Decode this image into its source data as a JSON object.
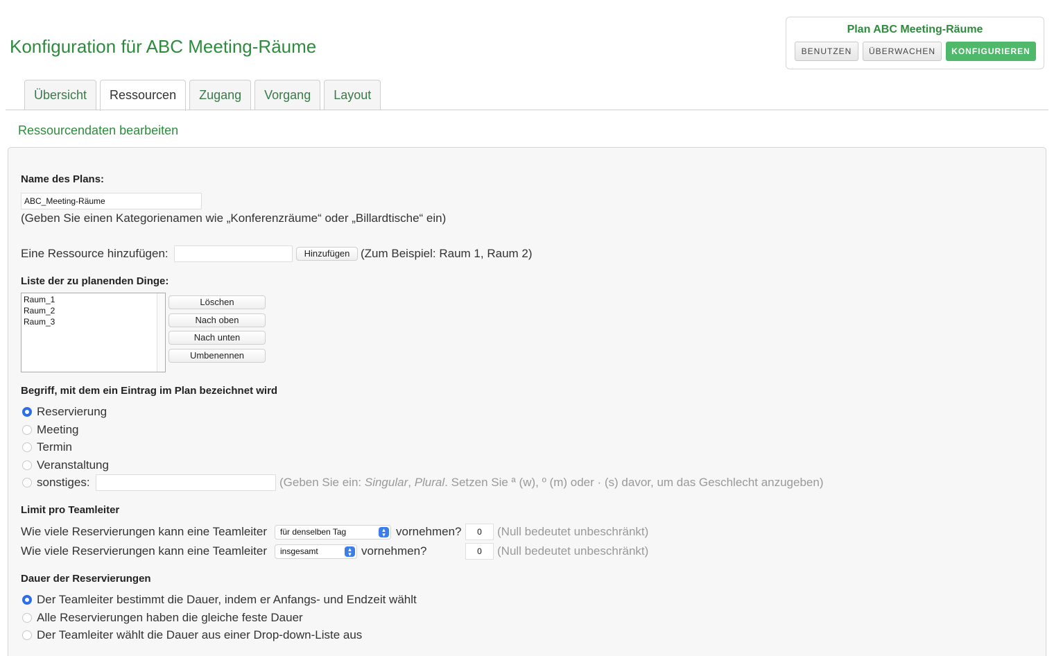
{
  "header": {
    "page_title": "Konfiguration für ABC Meeting-Räume",
    "plan_title": "Plan ABC Meeting-Räume",
    "mode_buttons": [
      "BENUTZEN",
      "ÜBERWACHEN",
      "KONFIGURIEREN"
    ],
    "active_mode": "KONFIGURIEREN"
  },
  "tabs": [
    {
      "label": "Übersicht",
      "active": false
    },
    {
      "label": "Ressourcen",
      "active": true
    },
    {
      "label": "Zugang",
      "active": false
    },
    {
      "label": "Vorgang",
      "active": false
    },
    {
      "label": "Layout",
      "active": false
    }
  ],
  "section_title": "Ressourcendaten bearbeiten",
  "form": {
    "plan_name": {
      "label": "Name des Plans:",
      "value": "ABC_Meeting-Räume",
      "hint": "(Geben Sie einen Kategorienamen wie „Konferenzräume“ oder „Billardtische“ ein)"
    },
    "add_resource": {
      "label": "Eine Ressource hinzufügen:",
      "value": "",
      "button": "Hinzufügen",
      "hint": "(Zum Beispiel: Raum 1, Raum 2)"
    },
    "resource_list": {
      "label": "Liste der zu planenden Dinge:",
      "items": [
        "Raum_1",
        "Raum_2",
        "Raum_3"
      ],
      "buttons": [
        "Löschen",
        "Nach oben",
        "Nach unten",
        "Umbenennen"
      ]
    },
    "entry_term": {
      "label": "Begriff, mit dem ein Eintrag im Plan bezeichnet wird",
      "options": [
        "Reservierung",
        "Meeting",
        "Termin",
        "Veranstaltung",
        "sonstiges:"
      ],
      "selected": "Reservierung",
      "other_value": "",
      "hint_prefix": "(Geben Sie ein: ",
      "hint_singular": "Singular",
      "hint_comma": ", ",
      "hint_plural": "Plural",
      "hint_suffix": ". Setzen Sie ª (w), º (m) oder · (s) davor, um das Geschlecht anzugeben)"
    },
    "limit": {
      "label": "Limit pro Teamleiter",
      "rows": [
        {
          "prefix": "Wie viele Reservierungen kann eine Teamleiter",
          "select": "für denselben Tag",
          "suffix": "vornehmen?",
          "value": "0",
          "hint": "(Null bedeutet unbeschränkt)"
        },
        {
          "prefix": "Wie viele Reservierungen kann eine Teamleiter",
          "select": "insgesamt",
          "suffix": "vornehmen?",
          "value": "0",
          "hint": "(Null bedeutet unbeschränkt)"
        }
      ]
    },
    "duration": {
      "label": "Dauer der Reservierungen",
      "options": [
        "Der Teamleiter bestimmt die Dauer, indem er Anfangs- und Endzeit wählt",
        "Alle Reservierungen haben die gleiche feste Dauer",
        "Der Teamleiter wählt die Dauer aus einer Drop-down-Liste aus"
      ],
      "selected_index": 0
    }
  }
}
